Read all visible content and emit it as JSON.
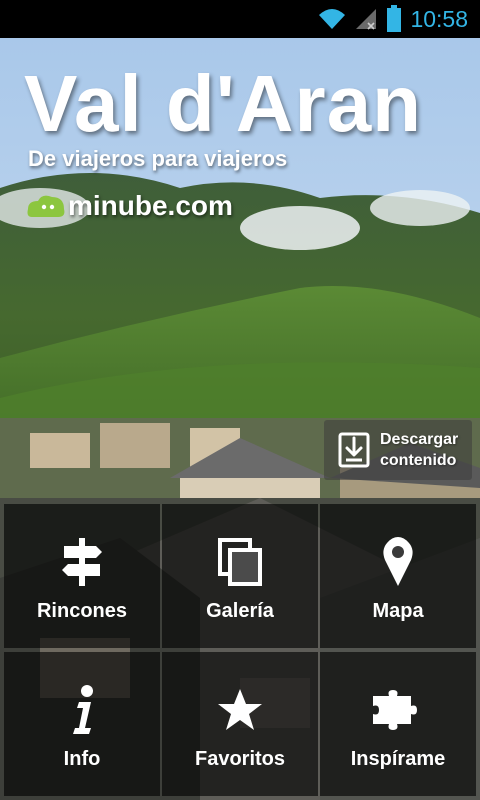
{
  "status_bar": {
    "time": "10:58",
    "icons": [
      "wifi-icon",
      "signal-icon",
      "battery-icon"
    ],
    "accent_color": "#33b5e5"
  },
  "header": {
    "title": "Val d'Aran",
    "subtitle": "De viajeros para viajeros",
    "brand": "minube.com",
    "brand_color": "#8cc63f"
  },
  "download": {
    "label": "Descargar\ncontenido",
    "icon": "download-icon"
  },
  "menu": {
    "items": [
      {
        "label": "Rincones",
        "icon": "signpost-icon"
      },
      {
        "label": "Galería",
        "icon": "gallery-icon"
      },
      {
        "label": "Mapa",
        "icon": "map-pin-icon"
      },
      {
        "label": "Info",
        "icon": "info-icon"
      },
      {
        "label": "Favoritos",
        "icon": "star-icon"
      },
      {
        "label": "Inspírame",
        "icon": "puzzle-icon"
      }
    ]
  }
}
